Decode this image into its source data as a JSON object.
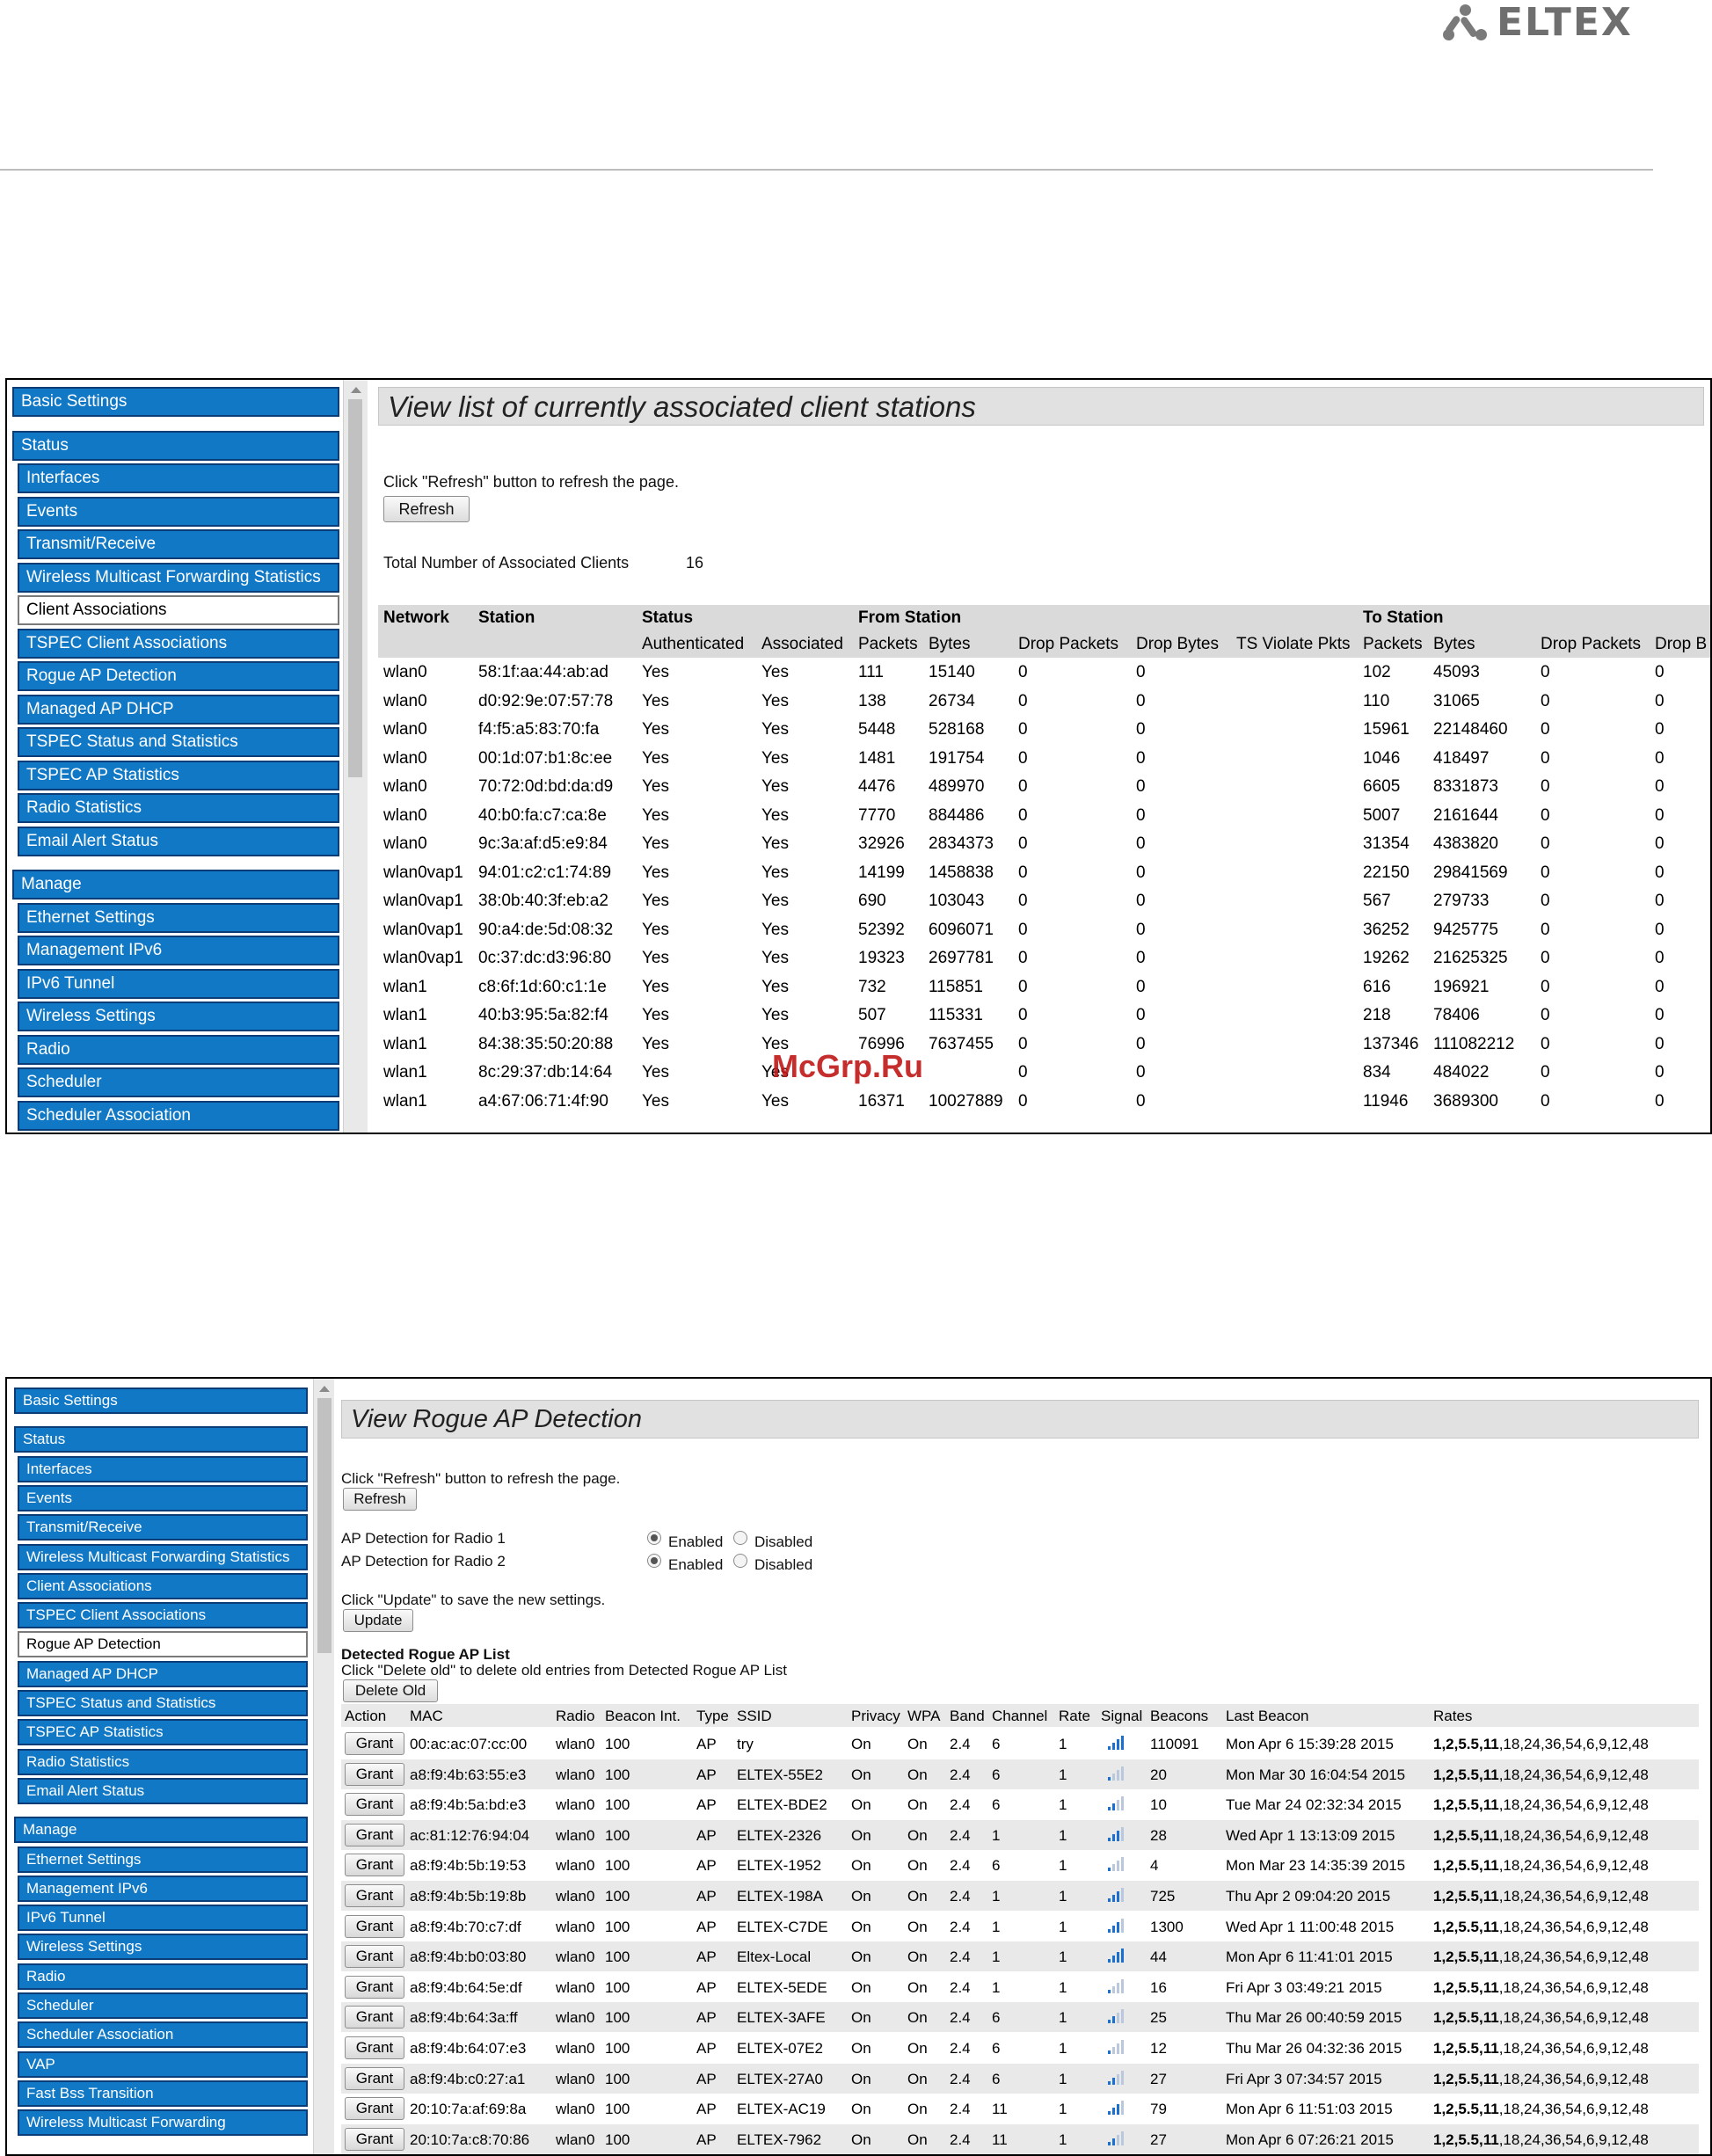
{
  "brand": {
    "logo_text": "ELTEX",
    "logo_color": "#6f6f6f"
  },
  "colors": {
    "sidebar_blue": "#1178c6",
    "sidebar_border": "#0a3d77",
    "signal_blue": "#1a6fd0"
  },
  "screen1": {
    "title": "View list of currently associated client stations",
    "refresh_hint": "Click \"Refresh\" button to refresh the page.",
    "refresh_button": "Refresh",
    "total_label": "Total Number of Associated Clients",
    "total_value": "16",
    "sidebar": [
      {
        "label": "Basic Settings",
        "type": "head"
      },
      {
        "label": "Status",
        "type": "head"
      },
      {
        "label": "Interfaces",
        "type": "item"
      },
      {
        "label": "Events",
        "type": "item"
      },
      {
        "label": "Transmit/Receive",
        "type": "item"
      },
      {
        "label": "Wireless Multicast Forwarding Statistics",
        "type": "item"
      },
      {
        "label": "Client Associations",
        "type": "item",
        "active": true
      },
      {
        "label": "TSPEC Client Associations",
        "type": "item"
      },
      {
        "label": "Rogue AP Detection",
        "type": "item"
      },
      {
        "label": "Managed AP DHCP",
        "type": "item"
      },
      {
        "label": "TSPEC Status and Statistics",
        "type": "item"
      },
      {
        "label": "TSPEC AP Statistics",
        "type": "item"
      },
      {
        "label": "Radio Statistics",
        "type": "item"
      },
      {
        "label": "Email Alert Status",
        "type": "item"
      },
      {
        "label": "Manage",
        "type": "head"
      },
      {
        "label": "Ethernet Settings",
        "type": "item"
      },
      {
        "label": "Management IPv6",
        "type": "item"
      },
      {
        "label": "IPv6 Tunnel",
        "type": "item"
      },
      {
        "label": "Wireless Settings",
        "type": "item"
      },
      {
        "label": "Radio",
        "type": "item"
      },
      {
        "label": "Scheduler",
        "type": "item"
      },
      {
        "label": "Scheduler Association",
        "type": "item"
      }
    ],
    "table": {
      "group_headers": [
        "Network",
        "Station",
        "Status",
        "From Station",
        "To Station"
      ],
      "sub_headers": [
        "Authenticated",
        "Associated",
        "Packets",
        "Bytes",
        "Drop Packets",
        "Drop Bytes",
        "TS Violate Pkts",
        "Packets",
        "Bytes",
        "Drop Packets",
        "Drop B"
      ],
      "rows": [
        [
          "wlan0",
          "58:1f:aa:44:ab:ad",
          "Yes",
          "Yes",
          "111",
          "15140",
          "0",
          "0",
          "102",
          "45093",
          "0",
          "0"
        ],
        [
          "wlan0",
          "d0:92:9e:07:57:78",
          "Yes",
          "Yes",
          "138",
          "26734",
          "0",
          "0",
          "110",
          "31065",
          "0",
          "0"
        ],
        [
          "wlan0",
          "f4:f5:a5:83:70:fa",
          "Yes",
          "Yes",
          "5448",
          "528168",
          "0",
          "0",
          "15961",
          "22148460",
          "0",
          "0"
        ],
        [
          "wlan0",
          "00:1d:07:b1:8c:ee",
          "Yes",
          "Yes",
          "1481",
          "191754",
          "0",
          "0",
          "1046",
          "418497",
          "0",
          "0"
        ],
        [
          "wlan0",
          "70:72:0d:bd:da:d9",
          "Yes",
          "Yes",
          "4476",
          "489970",
          "0",
          "0",
          "6605",
          "8331873",
          "0",
          "0"
        ],
        [
          "wlan0",
          "40:b0:fa:c7:ca:8e",
          "Yes",
          "Yes",
          "7770",
          "884486",
          "0",
          "0",
          "5007",
          "2161644",
          "0",
          "0"
        ],
        [
          "wlan0",
          "9c:3a:af:d5:e9:84",
          "Yes",
          "Yes",
          "32926",
          "2834373",
          "0",
          "0",
          "31354",
          "4383820",
          "0",
          "0"
        ],
        [
          "wlan0vap1",
          "94:01:c2:c1:74:89",
          "Yes",
          "Yes",
          "14199",
          "1458838",
          "0",
          "0",
          "22150",
          "29841569",
          "0",
          "0"
        ],
        [
          "wlan0vap1",
          "38:0b:40:3f:eb:a2",
          "Yes",
          "Yes",
          "690",
          "103043",
          "0",
          "0",
          "567",
          "279733",
          "0",
          "0"
        ],
        [
          "wlan0vap1",
          "90:a4:de:5d:08:32",
          "Yes",
          "Yes",
          "52392",
          "6096071",
          "0",
          "0",
          "36252",
          "9425775",
          "0",
          "0"
        ],
        [
          "wlan0vap1",
          "0c:37:dc:d3:96:80",
          "Yes",
          "Yes",
          "19323",
          "2697781",
          "0",
          "0",
          "19262",
          "21625325",
          "0",
          "0"
        ],
        [
          "wlan1",
          "c8:6f:1d:60:c1:1e",
          "Yes",
          "Yes",
          "732",
          "115851",
          "0",
          "0",
          "616",
          "196921",
          "0",
          "0"
        ],
        [
          "wlan1",
          "40:b3:95:5a:82:f4",
          "Yes",
          "Yes",
          "507",
          "115331",
          "0",
          "0",
          "218",
          "78406",
          "0",
          "0"
        ],
        [
          "wlan1",
          "84:38:35:50:20:88",
          "Yes",
          "Yes",
          "76996",
          "7637455",
          "0",
          "0",
          "137346",
          "111082212",
          "0",
          "0"
        ],
        [
          "wlan1",
          "8c:29:37:db:14:64",
          "Yes",
          "Yes",
          "",
          "",
          "0",
          "0",
          "834",
          "484022",
          "0",
          "0"
        ],
        [
          "wlan1",
          "a4:67:06:71:4f:90",
          "Yes",
          "Yes",
          "16371",
          "10027889",
          "0",
          "0",
          "11946",
          "3689300",
          "0",
          "0"
        ]
      ]
    }
  },
  "watermark": "McGrp.Ru",
  "screen2": {
    "title": "View Rogue AP Detection",
    "refresh_hint": "Click \"Refresh\" button to refresh the page.",
    "refresh_button": "Refresh",
    "radio1_label": "AP Detection for Radio 1",
    "radio2_label": "AP Detection for Radio 2",
    "enabled_label": "Enabled",
    "disabled_label": "Disabled",
    "radio1_value": "Enabled",
    "radio2_value": "Enabled",
    "update_hint": "Click \"Update\" to save the new settings.",
    "update_button": "Update",
    "list_title": "Detected Rogue AP List",
    "delete_hint": "Click \"Delete old\" to delete old entries from Detected Rogue AP List",
    "delete_button": "Delete Old",
    "grant_label": "Grant",
    "sidebar": [
      {
        "label": "Basic Settings",
        "type": "head"
      },
      {
        "label": "Status",
        "type": "head"
      },
      {
        "label": "Interfaces",
        "type": "item"
      },
      {
        "label": "Events",
        "type": "item"
      },
      {
        "label": "Transmit/Receive",
        "type": "item"
      },
      {
        "label": "Wireless Multicast Forwarding Statistics",
        "type": "item"
      },
      {
        "label": "Client Associations",
        "type": "item"
      },
      {
        "label": "TSPEC Client Associations",
        "type": "item"
      },
      {
        "label": "Rogue AP Detection",
        "type": "item",
        "active": true
      },
      {
        "label": "Managed AP DHCP",
        "type": "item"
      },
      {
        "label": "TSPEC Status and Statistics",
        "type": "item"
      },
      {
        "label": "TSPEC AP Statistics",
        "type": "item"
      },
      {
        "label": "Radio Statistics",
        "type": "item"
      },
      {
        "label": "Email Alert Status",
        "type": "item"
      },
      {
        "label": "Manage",
        "type": "head"
      },
      {
        "label": "Ethernet Settings",
        "type": "item"
      },
      {
        "label": "Management IPv6",
        "type": "item"
      },
      {
        "label": "IPv6 Tunnel",
        "type": "item"
      },
      {
        "label": "Wireless Settings",
        "type": "item"
      },
      {
        "label": "Radio",
        "type": "item"
      },
      {
        "label": "Scheduler",
        "type": "item"
      },
      {
        "label": "Scheduler Association",
        "type": "item"
      },
      {
        "label": "VAP",
        "type": "item"
      },
      {
        "label": "Fast Bss Transition",
        "type": "item"
      },
      {
        "label": "Wireless Multicast Forwarding",
        "type": "item"
      }
    ],
    "table": {
      "headers": [
        "Action",
        "MAC",
        "Radio",
        "Beacon Int.",
        "Type",
        "SSID",
        "Privacy",
        "WPA",
        "Band",
        "Channel",
        "Rate",
        "Signal",
        "Beacons",
        "Last Beacon",
        "Rates"
      ],
      "rates_bold": "1,2,5.5,11",
      "rates_rest": ",18,24,36,54,6,9,12,48",
      "rows": [
        {
          "mac": "00:ac:ac:07:cc:00",
          "radio": "wlan0",
          "beacon": "100",
          "type": "AP",
          "ssid": "try",
          "privacy": "On",
          "wpa": "On",
          "band": "2.4",
          "channel": "6",
          "rate": "1",
          "signal": 4,
          "beacons": "110091",
          "last": "Mon Apr 6 15:39:28 2015"
        },
        {
          "mac": "a8:f9:4b:63:55:e3",
          "radio": "wlan0",
          "beacon": "100",
          "type": "AP",
          "ssid": "ELTEX-55E2",
          "privacy": "On",
          "wpa": "On",
          "band": "2.4",
          "channel": "6",
          "rate": "1",
          "signal": 1,
          "beacons": "20",
          "last": "Mon Mar 30 16:04:54 2015"
        },
        {
          "mac": "a8:f9:4b:5a:bd:e3",
          "radio": "wlan0",
          "beacon": "100",
          "type": "AP",
          "ssid": "ELTEX-BDE2",
          "privacy": "On",
          "wpa": "On",
          "band": "2.4",
          "channel": "6",
          "rate": "1",
          "signal": 2,
          "beacons": "10",
          "last": "Tue Mar 24 02:32:34 2015"
        },
        {
          "mac": "ac:81:12:76:94:04",
          "radio": "wlan0",
          "beacon": "100",
          "type": "AP",
          "ssid": "ELTEX-2326",
          "privacy": "On",
          "wpa": "On",
          "band": "2.4",
          "channel": "1",
          "rate": "1",
          "signal": 3,
          "beacons": "28",
          "last": "Wed Apr 1 13:13:09 2015"
        },
        {
          "mac": "a8:f9:4b:5b:19:53",
          "radio": "wlan0",
          "beacon": "100",
          "type": "AP",
          "ssid": "ELTEX-1952",
          "privacy": "On",
          "wpa": "On",
          "band": "2.4",
          "channel": "6",
          "rate": "1",
          "signal": 1,
          "beacons": "4",
          "last": "Mon Mar 23 14:35:39 2015"
        },
        {
          "mac": "a8:f9:4b:5b:19:8b",
          "radio": "wlan0",
          "beacon": "100",
          "type": "AP",
          "ssid": "ELTEX-198A",
          "privacy": "On",
          "wpa": "On",
          "band": "2.4",
          "channel": "1",
          "rate": "1",
          "signal": 3,
          "beacons": "725",
          "last": "Thu Apr 2 09:04:20 2015"
        },
        {
          "mac": "a8:f9:4b:70:c7:df",
          "radio": "wlan0",
          "beacon": "100",
          "type": "AP",
          "ssid": "ELTEX-C7DE",
          "privacy": "On",
          "wpa": "On",
          "band": "2.4",
          "channel": "1",
          "rate": "1",
          "signal": 3,
          "beacons": "1300",
          "last": "Wed Apr 1 11:00:48 2015"
        },
        {
          "mac": "a8:f9:4b:b0:03:80",
          "radio": "wlan0",
          "beacon": "100",
          "type": "AP",
          "ssid": "Eltex-Local",
          "privacy": "On",
          "wpa": "On",
          "band": "2.4",
          "channel": "1",
          "rate": "1",
          "signal": 4,
          "beacons": "44",
          "last": "Mon Apr 6 11:41:01 2015"
        },
        {
          "mac": "a8:f9:4b:64:5e:df",
          "radio": "wlan0",
          "beacon": "100",
          "type": "AP",
          "ssid": "ELTEX-5EDE",
          "privacy": "On",
          "wpa": "On",
          "band": "2.4",
          "channel": "1",
          "rate": "1",
          "signal": 1,
          "beacons": "16",
          "last": "Fri Apr 3 03:49:21 2015"
        },
        {
          "mac": "a8:f9:4b:64:3a:ff",
          "radio": "wlan0",
          "beacon": "100",
          "type": "AP",
          "ssid": "ELTEX-3AFE",
          "privacy": "On",
          "wpa": "On",
          "band": "2.4",
          "channel": "6",
          "rate": "1",
          "signal": 2,
          "beacons": "25",
          "last": "Thu Mar 26 00:40:59 2015"
        },
        {
          "mac": "a8:f9:4b:64:07:e3",
          "radio": "wlan0",
          "beacon": "100",
          "type": "AP",
          "ssid": "ELTEX-07E2",
          "privacy": "On",
          "wpa": "On",
          "band": "2.4",
          "channel": "6",
          "rate": "1",
          "signal": 1,
          "beacons": "12",
          "last": "Thu Mar 26 04:32:36 2015"
        },
        {
          "mac": "a8:f9:4b:c0:27:a1",
          "radio": "wlan0",
          "beacon": "100",
          "type": "AP",
          "ssid": "ELTEX-27A0",
          "privacy": "On",
          "wpa": "On",
          "band": "2.4",
          "channel": "6",
          "rate": "1",
          "signal": 2,
          "beacons": "27",
          "last": "Fri Apr 3 07:34:57 2015"
        },
        {
          "mac": "20:10:7a:af:69:8a",
          "radio": "wlan0",
          "beacon": "100",
          "type": "AP",
          "ssid": "ELTEX-AC19",
          "privacy": "On",
          "wpa": "On",
          "band": "2.4",
          "channel": "11",
          "rate": "1",
          "signal": 3,
          "beacons": "79",
          "last": "Mon Apr 6 11:51:03 2015"
        },
        {
          "mac": "20:10:7a:c8:70:86",
          "radio": "wlan0",
          "beacon": "100",
          "type": "AP",
          "ssid": "ELTEX-7962",
          "privacy": "On",
          "wpa": "On",
          "band": "2.4",
          "channel": "11",
          "rate": "1",
          "signal": 2,
          "beacons": "27",
          "last": "Mon Apr 6 07:26:21 2015"
        }
      ]
    }
  }
}
